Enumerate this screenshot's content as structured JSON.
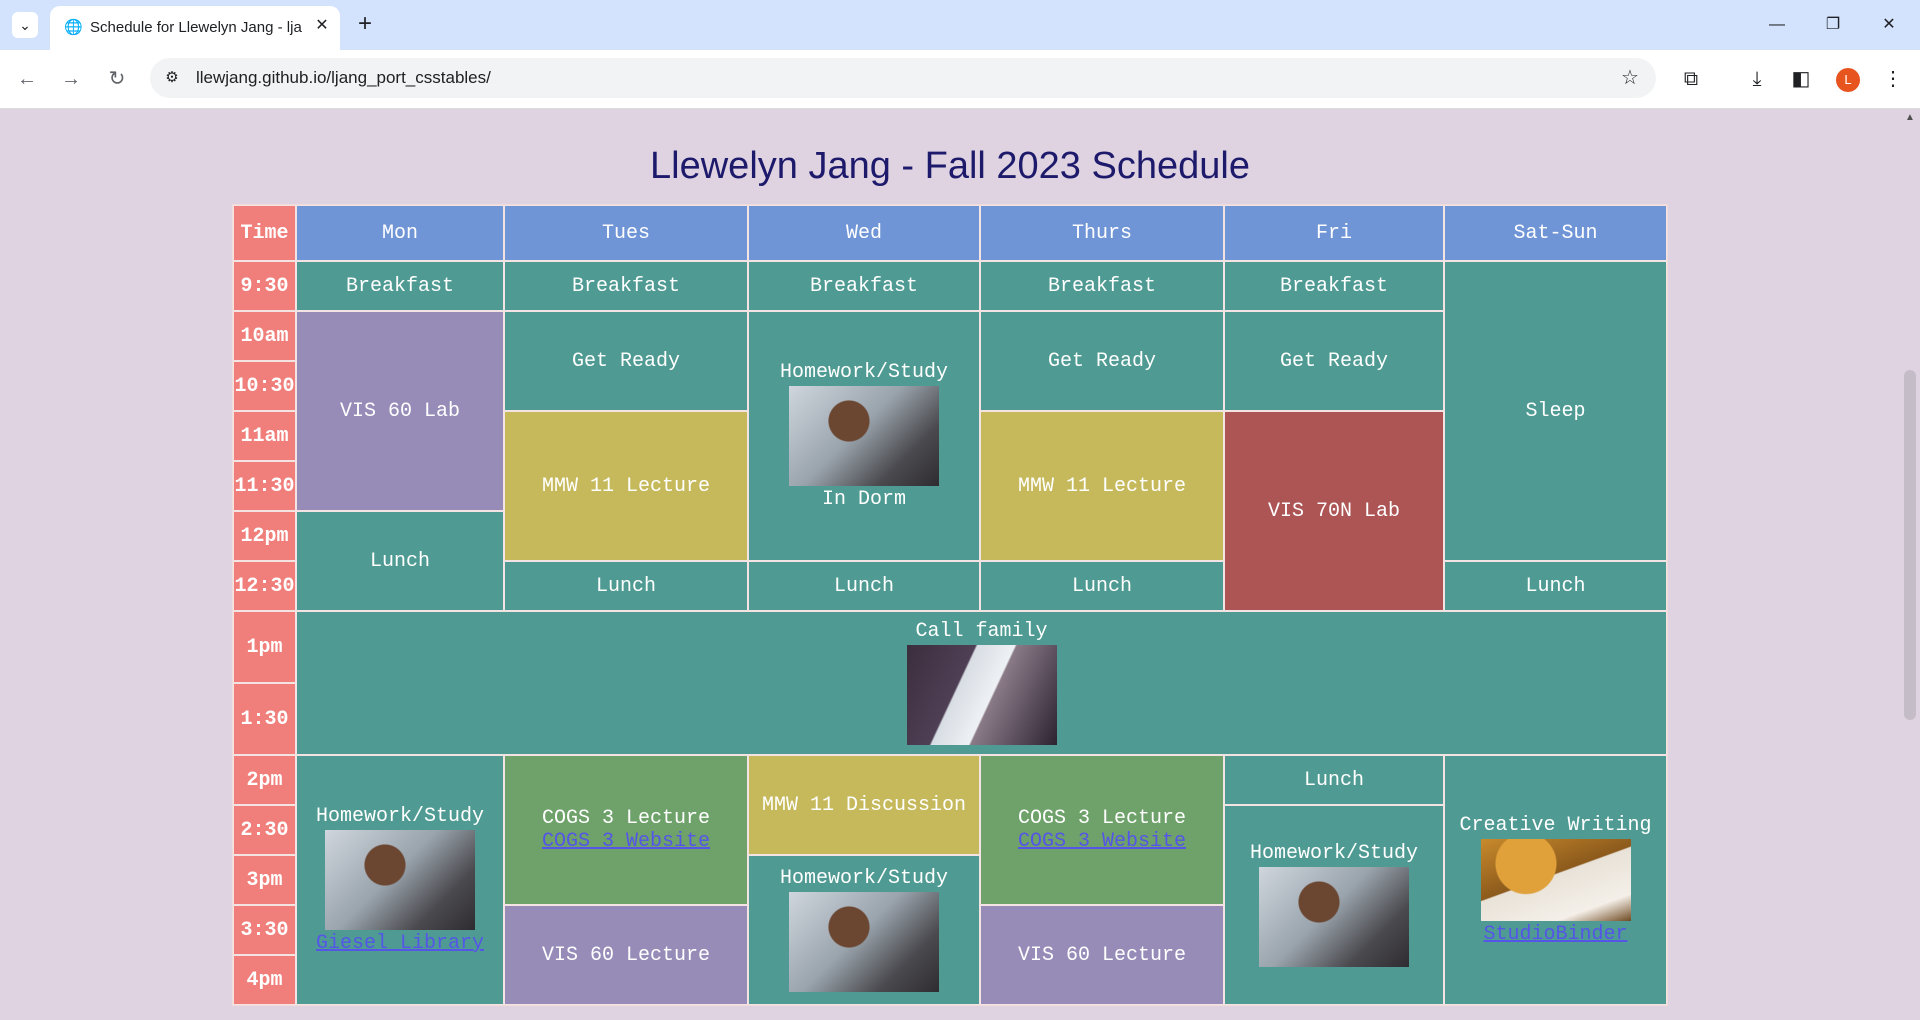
{
  "browser": {
    "tab_title": "Schedule for Llewelyn Jang - lja",
    "url": "llewjang.github.io/ljang_port_csstables/",
    "avatar_letter": "L"
  },
  "page": {
    "title": "Llewelyn Jang - Fall 2023 Schedule"
  },
  "schedule": {
    "headers": [
      "Time",
      "Mon",
      "Tues",
      "Wed",
      "Thurs",
      "Fri",
      "Sat-Sun"
    ],
    "times": [
      "9:30",
      "10am",
      "10:30",
      "11am",
      "11:30",
      "12pm",
      "12:30",
      "1pm",
      "1:30",
      "2pm",
      "2:30",
      "3pm",
      "3:30",
      "4pm"
    ],
    "events": {
      "breakfast": "Breakfast",
      "get_ready": "Get Ready",
      "vis60_lab": "VIS 60 Lab",
      "homework_study": "Homework/Study",
      "in_dorm": "In Dorm",
      "mmw11_lecture": "MMW 11 Lecture",
      "vis70n_lab": "VIS 70N Lab",
      "sleep": "Sleep",
      "lunch": "Lunch",
      "call_family": "Call family",
      "cogs3_lecture": "COGS 3 Lecture",
      "cogs3_link": "COGS 3 Website",
      "mmw11_discussion": "MMW 11 Discussion",
      "giesel_link": "Giesel Library",
      "vis60_lecture": "VIS 60 Lecture",
      "creative_writing": "Creative Writing",
      "studiobinder_link": "StudioBinder"
    }
  },
  "colors": {
    "time_column": "#f07f7b",
    "header": "#7095d6",
    "routine": "#4f9b93",
    "vis_lab": "#978bb8",
    "mmw": "#c6b95c",
    "vis70n": "#ad5454",
    "cogs": "#6ea26a"
  }
}
